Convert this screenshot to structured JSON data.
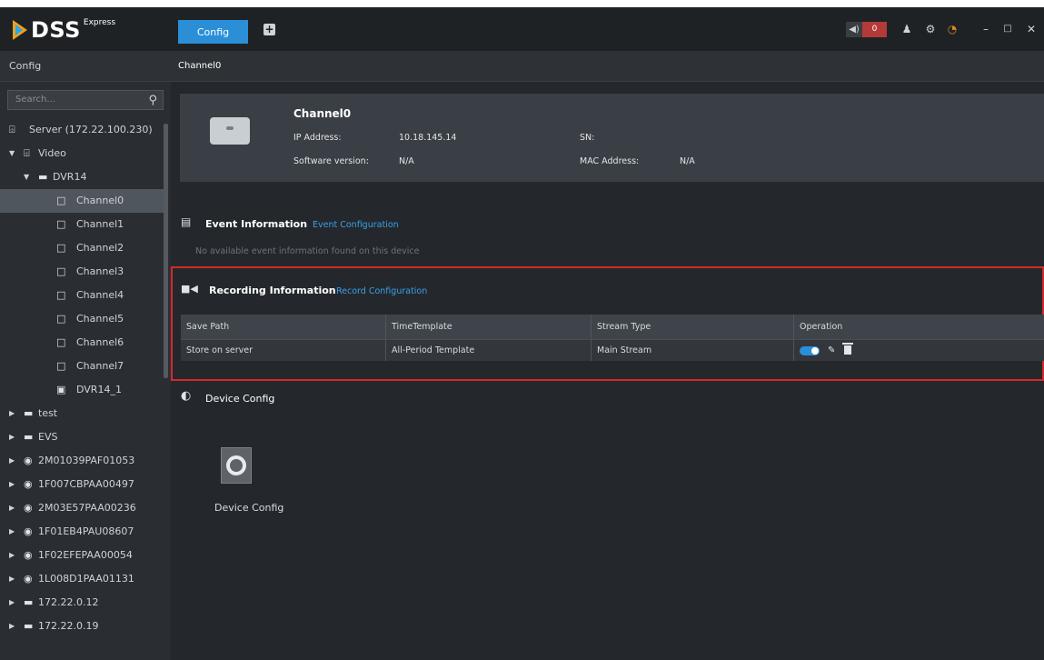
{
  "app": {
    "logo_text": "DSS",
    "logo_edition": "Express",
    "tab_label": "Config",
    "tab_add_icon": "plus-square-icon",
    "alarm_count": "0",
    "icons": [
      "speaker-icon",
      "user-icon",
      "gear-icon",
      "performance-gauge-icon",
      "minimize-icon",
      "maximize-icon",
      "close-icon"
    ],
    "accent_color": "#2b8fd8",
    "alarm_color": "#b43a3a",
    "highlight_color": "#d42a2a"
  },
  "sidebar": {
    "title": "Config",
    "search_placeholder": "Search...",
    "tree": [
      {
        "label": "Server (172.22.100.230)",
        "icon": "server-icon",
        "indent": 0,
        "arrow": ""
      },
      {
        "label": "Video",
        "icon": "server-icon",
        "indent": 0,
        "arrow": "down"
      },
      {
        "label": "DVR14",
        "icon": "dvr-icon",
        "indent": 1,
        "arrow": "down"
      },
      {
        "label": "Channel0",
        "icon": "camera-icon",
        "indent": 2,
        "arrow": "",
        "selected": true
      },
      {
        "label": "Channel1",
        "icon": "camera-icon",
        "indent": 2,
        "arrow": ""
      },
      {
        "label": "Channel2",
        "icon": "camera-icon",
        "indent": 2,
        "arrow": ""
      },
      {
        "label": "Channel3",
        "icon": "camera-icon",
        "indent": 2,
        "arrow": ""
      },
      {
        "label": "Channel4",
        "icon": "camera-icon",
        "indent": 2,
        "arrow": ""
      },
      {
        "label": "Channel5",
        "icon": "camera-icon",
        "indent": 2,
        "arrow": ""
      },
      {
        "label": "Channel6",
        "icon": "camera-icon",
        "indent": 2,
        "arrow": ""
      },
      {
        "label": "Channel7",
        "icon": "camera-icon",
        "indent": 2,
        "arrow": ""
      },
      {
        "label": "DVR14_1",
        "icon": "alarm-input-icon",
        "indent": 2,
        "arrow": ""
      },
      {
        "label": "test",
        "icon": "dvr-icon",
        "indent": 0,
        "arrow": "right"
      },
      {
        "label": "EVS",
        "icon": "dvr-icon",
        "indent": 0,
        "arrow": "right"
      },
      {
        "label": "2M01039PAF01053",
        "icon": "ptz-camera-icon",
        "indent": 0,
        "arrow": "right"
      },
      {
        "label": "1F007CBPAA00497",
        "icon": "ptz-camera-icon",
        "indent": 0,
        "arrow": "right"
      },
      {
        "label": "2M03E57PAA00236",
        "icon": "ptz-camera-icon",
        "indent": 0,
        "arrow": "right"
      },
      {
        "label": "1F01EB4PAU08607",
        "icon": "ptz-camera-icon",
        "indent": 0,
        "arrow": "right"
      },
      {
        "label": "1F02EFEPAA00054",
        "icon": "ptz-camera-icon",
        "indent": 0,
        "arrow": "right"
      },
      {
        "label": "1L008D1PAA01131",
        "icon": "ptz-camera-icon",
        "indent": 0,
        "arrow": "right"
      },
      {
        "label": "172.22.0.12",
        "icon": "dvr-icon",
        "indent": 0,
        "arrow": "right"
      },
      {
        "label": "172.22.0.19",
        "icon": "dvr-icon",
        "indent": 0,
        "arrow": "right"
      }
    ]
  },
  "main": {
    "breadcrumb": "Channel0",
    "device": {
      "name": "Channel0",
      "ip_label": "IP Address:",
      "ip_value": "10.18.145.14",
      "sn_label": "SN:",
      "sn_value": "",
      "sw_label": "Software version:",
      "sw_value": "N/A",
      "mac_label": "MAC Address:",
      "mac_value": "N/A"
    },
    "event": {
      "title": "Event Information",
      "link": "Event Configuration",
      "empty_text": "No available event information found on this device"
    },
    "recording": {
      "title": "Recording Information",
      "link": "Record Configuration",
      "columns": [
        "Save Path",
        "TimeTemplate",
        "Stream Type",
        "Operation"
      ],
      "rows": [
        {
          "save_path": "Store on server",
          "time_template": "All-Period Template",
          "stream_type": "Main Stream",
          "enabled": true
        }
      ]
    },
    "device_config": {
      "title": "Device Config",
      "item_label": "Device Config"
    }
  }
}
